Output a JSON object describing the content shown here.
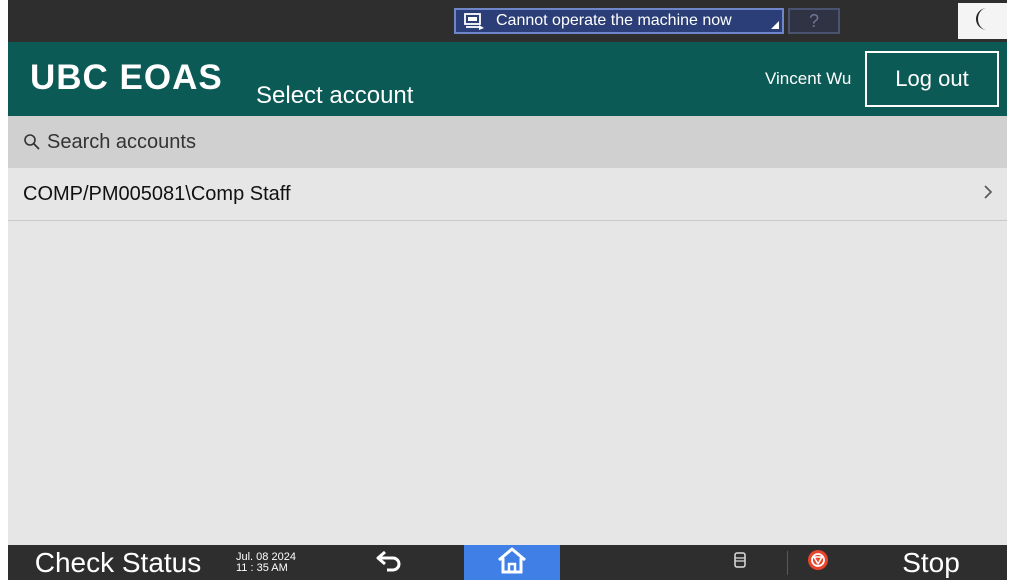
{
  "statusbar": {
    "message": "Cannot operate the machine now",
    "help_label": "?"
  },
  "header": {
    "brand": "UBC EOAS",
    "subtitle": "Select account",
    "user": "Vincent Wu",
    "logout_label": "Log out"
  },
  "search": {
    "placeholder": "Search accounts",
    "value": ""
  },
  "accounts": [
    {
      "label": "COMP/PM005081\\Comp Staff"
    }
  ],
  "bottombar": {
    "check_status": "Check Status",
    "date": "Jul. 08 2024",
    "time": "11 : 35 AM",
    "stop_label": "Stop"
  },
  "colors": {
    "header_bg": "#0b5a56",
    "home_button": "#3f7fe6",
    "stop_icon": "#e8452c",
    "message_box": "#2b3e77"
  },
  "icons": [
    "device-status-icon",
    "night-mode-icon",
    "search-icon",
    "chevron-right-icon",
    "back-icon",
    "home-icon",
    "sd-card-icon",
    "stop-icon"
  ]
}
